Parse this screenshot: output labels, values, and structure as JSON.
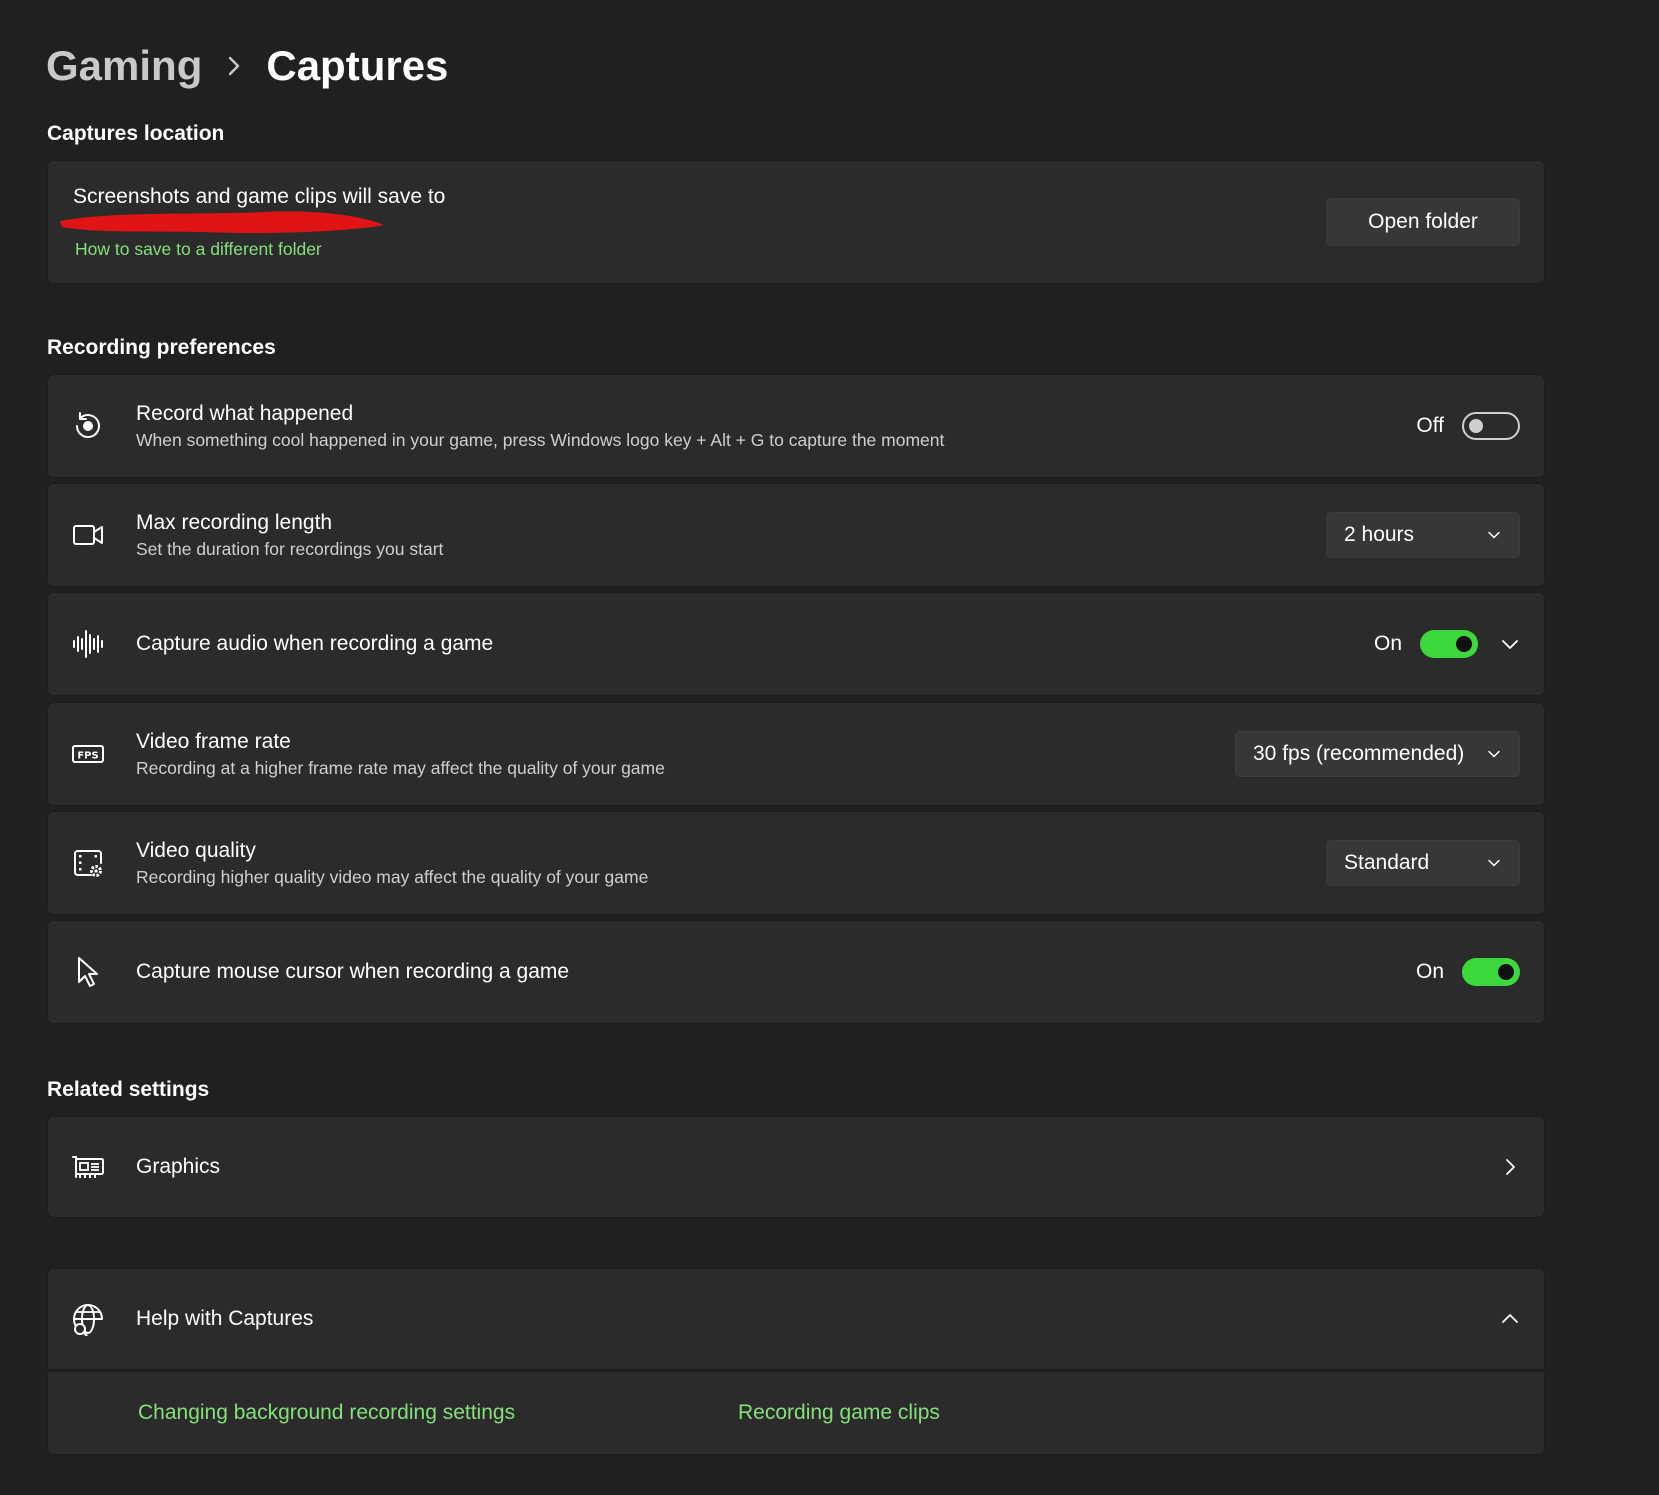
{
  "breadcrumb": {
    "parent": "Gaming",
    "current": "Captures"
  },
  "sections": {
    "captures_location": "Captures location",
    "recording_preferences": "Recording preferences",
    "related_settings": "Related settings"
  },
  "location_card": {
    "text": "Screenshots and game clips will save to",
    "link": "How to save to a different folder",
    "button": "Open folder"
  },
  "rows": {
    "record_what_happened": {
      "title": "Record what happened",
      "subtitle": "When something cool happened in your game, press Windows logo key + Alt + G to capture the moment",
      "state": "Off"
    },
    "max_recording_length": {
      "title": "Max recording length",
      "subtitle": "Set the duration for recordings you start",
      "value": "2 hours"
    },
    "capture_audio": {
      "title": "Capture audio when recording a game",
      "state": "On"
    },
    "video_frame_rate": {
      "title": "Video frame rate",
      "subtitle": "Recording at a higher frame rate may affect the quality of your game",
      "value": "30 fps (recommended)"
    },
    "video_quality": {
      "title": "Video quality",
      "subtitle": "Recording higher quality video may affect the quality of your game",
      "value": "Standard"
    },
    "capture_mouse_cursor": {
      "title": "Capture mouse cursor when recording a game",
      "state": "On"
    }
  },
  "related": {
    "graphics": "Graphics"
  },
  "help": {
    "title": "Help with Captures",
    "links": [
      "Changing background recording settings",
      "Recording game clips"
    ]
  },
  "colors": {
    "accent": "#3cd83c",
    "link": "#84e07a",
    "background": "#202020",
    "card": "#2b2b2b"
  }
}
